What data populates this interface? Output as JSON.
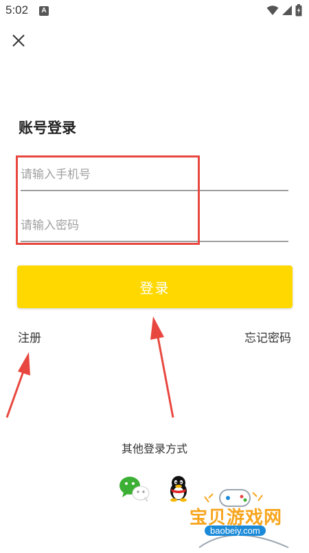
{
  "status_bar": {
    "time": "5:02",
    "badge": "A"
  },
  "header": {
    "close_icon": "close-icon"
  },
  "login": {
    "title": "账号登录",
    "phone_placeholder": "请输入手机号",
    "password_placeholder": "请输入密码",
    "submit_label": "登录",
    "register_label": "注册",
    "forgot_label": "忘记密码"
  },
  "social": {
    "title": "其他登录方式",
    "items": [
      {
        "name": "wechat",
        "icon": "wechat-icon"
      },
      {
        "name": "qq",
        "icon": "qq-icon"
      }
    ]
  },
  "watermark": {
    "title": "宝贝游戏网",
    "url": "baobeiy.com"
  },
  "colors": {
    "accent": "#ffd800",
    "annotation": "#e8473f",
    "watermark": "#f7a51c"
  }
}
